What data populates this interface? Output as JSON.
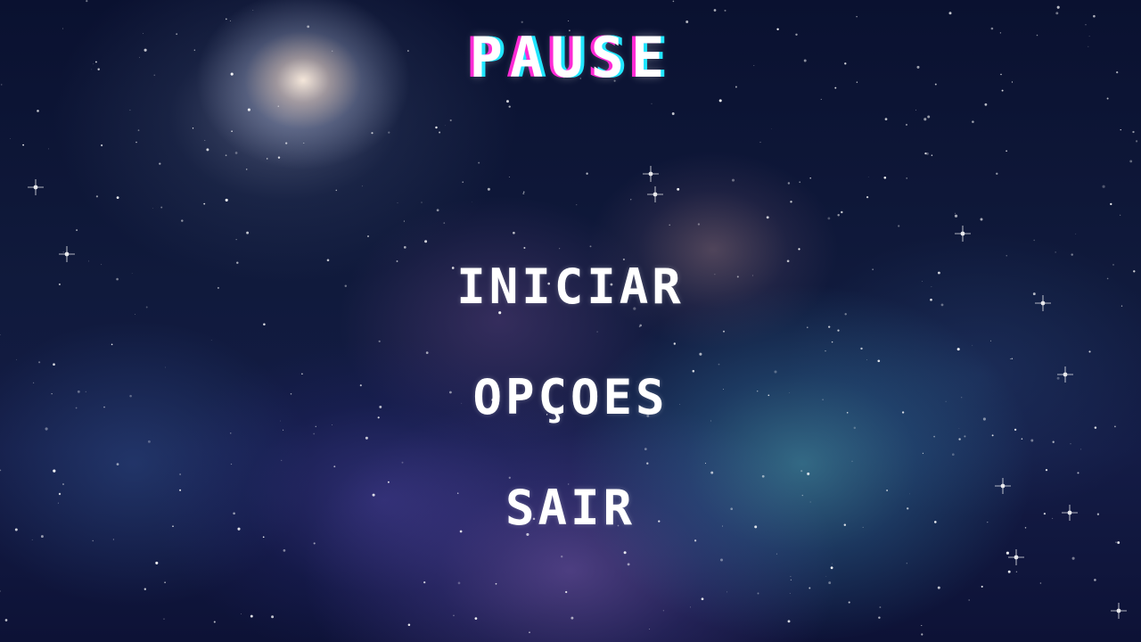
{
  "pause_menu": {
    "title": "PAUSE",
    "items": [
      {
        "label": "INICIAR"
      },
      {
        "label": "OPÇOES"
      },
      {
        "label": "SAIR"
      }
    ]
  },
  "colors": {
    "title_glitch_left": "#ff2bd6",
    "title_glitch_right": "#20e6ff",
    "text": "#ffffff",
    "space_dark": "#0a1130"
  }
}
